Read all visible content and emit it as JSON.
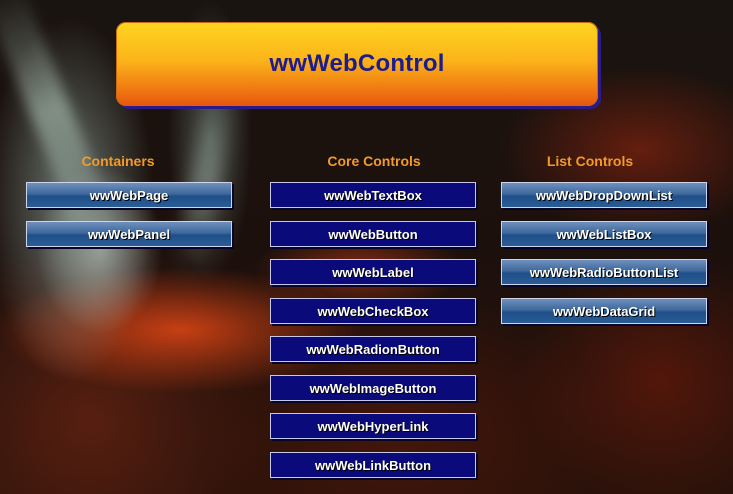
{
  "header": {
    "title": "wwWebControl"
  },
  "columns": {
    "containers": {
      "heading": "Containers",
      "items": [
        "wwWebPage",
        "wwWebPanel"
      ]
    },
    "core": {
      "heading": "Core Controls",
      "items": [
        "wwWebTextBox",
        "wwWebButton",
        "wwWebLabel",
        "wwWebCheckBox",
        "wwWebRadionButton",
        "wwWebImageButton",
        "wwWebHyperLink",
        "wwWebLinkButton"
      ]
    },
    "list": {
      "heading": "List Controls",
      "items": [
        "wwWebDropDownList",
        "wwWebListBox",
        "wwWebRadioButtonList",
        "wwWebDataGrid"
      ]
    }
  },
  "colors": {
    "banner_text": "#1c1c8c",
    "heading": "#f39a2a",
    "button_blue": "#3f689c",
    "button_navy": "#0b0a7a"
  }
}
